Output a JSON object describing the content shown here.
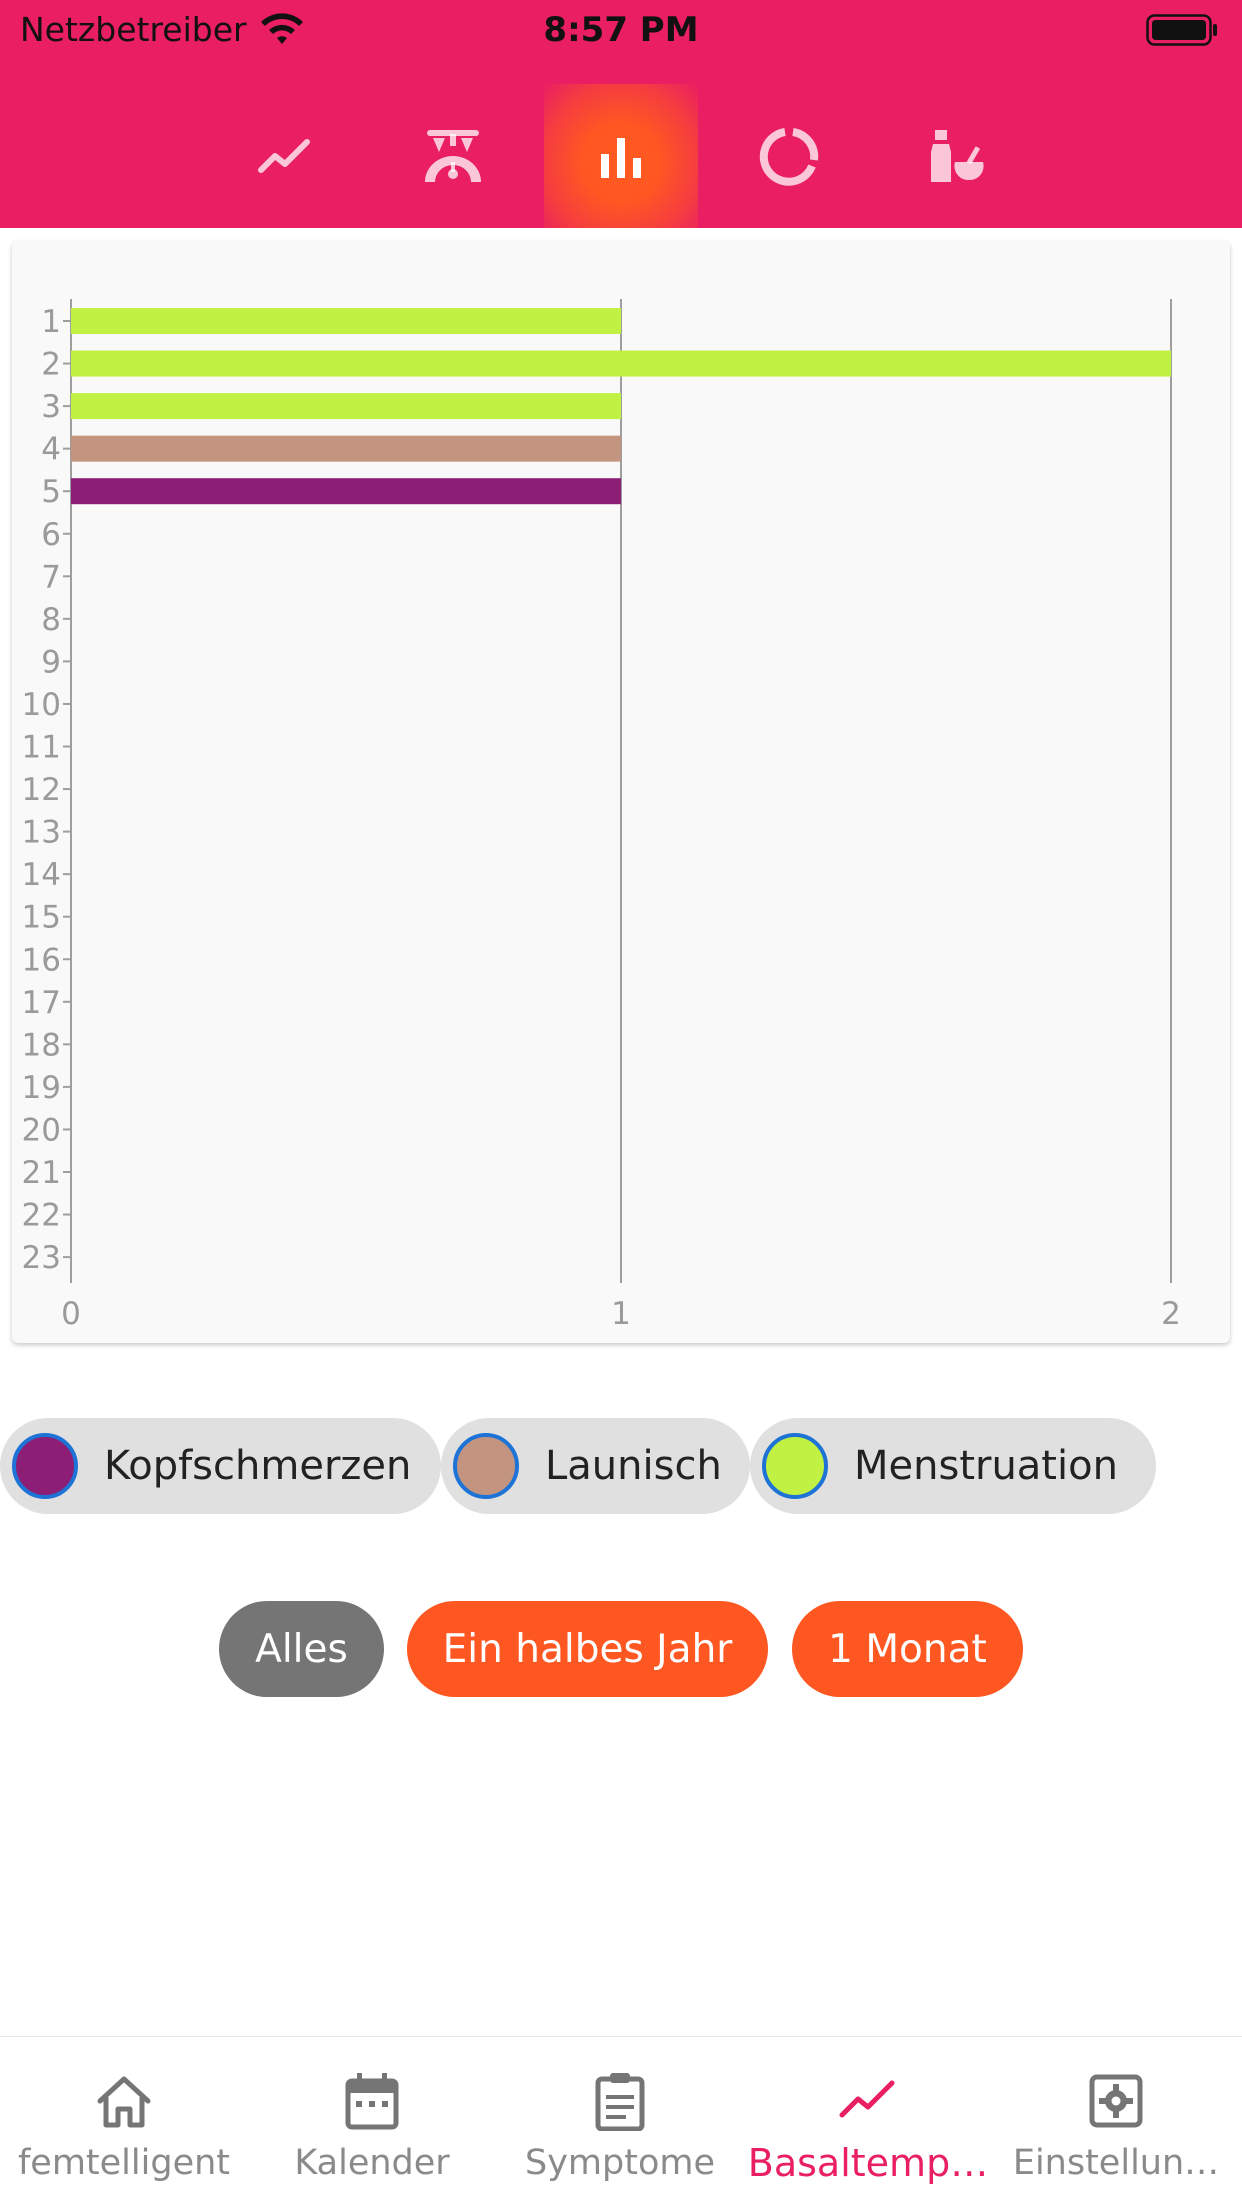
{
  "status_bar": {
    "carrier": "Netzbetreiber",
    "time": "8:57 PM",
    "icons": [
      "wifi-icon",
      "battery-icon"
    ]
  },
  "top_tabs": [
    {
      "icon": "line-chart-icon",
      "active": false
    },
    {
      "icon": "scale-icon",
      "active": false
    },
    {
      "icon": "bar-chart-icon",
      "active": true
    },
    {
      "icon": "donut-chart-icon",
      "active": false
    },
    {
      "icon": "medicine-icon",
      "active": false
    }
  ],
  "chart_data": {
    "type": "bar",
    "orientation": "horizontal",
    "categories": [
      "1",
      "2",
      "3",
      "4",
      "5",
      "6",
      "7",
      "8",
      "9",
      "10",
      "11",
      "12",
      "13",
      "14",
      "15",
      "16",
      "17",
      "18",
      "19",
      "20",
      "21",
      "22",
      "23"
    ],
    "series": [
      {
        "name": "Menstruation",
        "color": "#c1f142",
        "values": [
          1,
          2,
          1,
          0,
          0,
          0,
          0,
          0,
          0,
          0,
          0,
          0,
          0,
          0,
          0,
          0,
          0,
          0,
          0,
          0,
          0,
          0,
          0
        ]
      },
      {
        "name": "Launisch",
        "color": "#c39581",
        "values": [
          0,
          0,
          0,
          1,
          0,
          0,
          0,
          0,
          0,
          0,
          0,
          0,
          0,
          0,
          0,
          0,
          0,
          0,
          0,
          0,
          0,
          0,
          0
        ]
      },
      {
        "name": "Kopfschmerzen",
        "color": "#8c1f75",
        "values": [
          0,
          0,
          0,
          0,
          1,
          0,
          0,
          0,
          0,
          0,
          0,
          0,
          0,
          0,
          0,
          0,
          0,
          0,
          0,
          0,
          0,
          0,
          0
        ]
      }
    ],
    "x_ticks": [
      "0",
      "1",
      "2"
    ],
    "xlim": [
      0,
      2
    ],
    "grid": "vertical",
    "legend_position": "bottom"
  },
  "legend": [
    {
      "label": "Kopfschmerzen",
      "color": "#8c1f75"
    },
    {
      "label": "Launisch",
      "color": "#c39581"
    },
    {
      "label": "Menstruation",
      "color": "#c1f142"
    }
  ],
  "range_buttons": {
    "all": "Alles",
    "half_year": "Ein halbes Jahr",
    "month": "1 Monat"
  },
  "bottom_nav": [
    {
      "label": "femtelligent",
      "icon": "home-icon"
    },
    {
      "label": "Kalender",
      "icon": "calendar-icon"
    },
    {
      "label": "Symptome",
      "icon": "clipboard-icon"
    },
    {
      "label": "Basaltemp…",
      "icon": "line-chart-icon",
      "active": true
    },
    {
      "label": "Einstellun…",
      "icon": "settings-icon"
    }
  ],
  "colors": {
    "primary": "#e91e63",
    "accent": "#ff5722",
    "neutral_button": "#757575"
  }
}
